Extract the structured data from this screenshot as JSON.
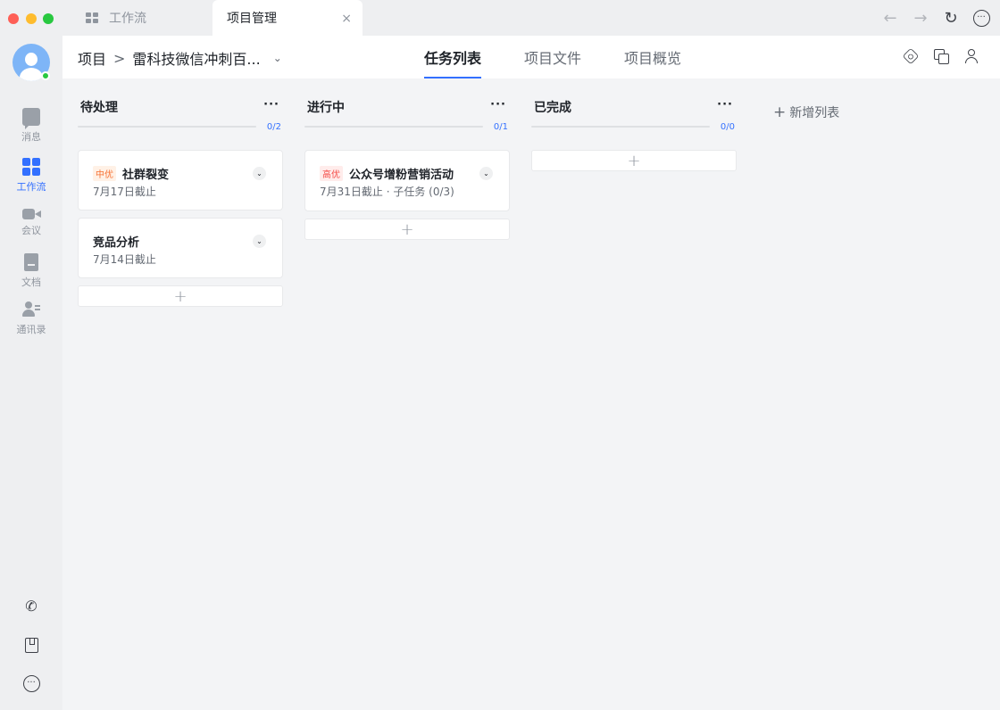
{
  "tabs": [
    {
      "label": "工作流",
      "active": false
    },
    {
      "label": "项目管理",
      "active": true
    }
  ],
  "tab_close_icon": "×",
  "nav": {
    "back": "←",
    "forward": "→",
    "refresh": "↻",
    "more": "···"
  },
  "sidebar": {
    "items": [
      {
        "label": "消息",
        "icon": "message-icon"
      },
      {
        "label": "工作流",
        "icon": "workflow-icon",
        "active": true
      },
      {
        "label": "会议",
        "icon": "video-icon"
      },
      {
        "label": "文档",
        "icon": "document-icon"
      },
      {
        "label": "通讯录",
        "icon": "contacts-icon"
      }
    ],
    "bottom_icons": [
      "phone-video-icon",
      "bookmark-icon",
      "more-icon"
    ],
    "phone_glyph": "✆",
    "more_glyph": "···"
  },
  "header": {
    "breadcrumb_root": "项目",
    "breadcrumb_sep": ">",
    "project_name": "雷科技微信冲刺百...",
    "chevron": "⌄",
    "view_tabs": [
      "任务列表",
      "项目文件",
      "项目概览"
    ],
    "active_view": "任务列表"
  },
  "columns": [
    {
      "title": "待处理",
      "more": "···",
      "count": "0/2",
      "progress": 0,
      "cards": [
        {
          "priority": "中优",
          "priority_level": "mid",
          "title": "社群裂变",
          "sub": "7月17日截止"
        },
        {
          "priority": "",
          "title": "竞品分析",
          "sub": "7月14日截止"
        }
      ]
    },
    {
      "title": "进行中",
      "more": "···",
      "count": "0/1",
      "progress": 0,
      "cards": [
        {
          "priority": "高优",
          "priority_level": "high",
          "title": "公众号增粉营销活动",
          "sub": "7月31日截止 · 子任务 (0/3)"
        }
      ]
    },
    {
      "title": "已完成",
      "more": "···",
      "count": "0/0",
      "progress": 0,
      "cards": []
    }
  ],
  "add_glyph": "+",
  "expand_glyph": "⌄",
  "new_list_label": "新增列表",
  "colors": {
    "accent": "#3370ff",
    "mid_priority": "#f77234",
    "high_priority": "#f54a45"
  }
}
